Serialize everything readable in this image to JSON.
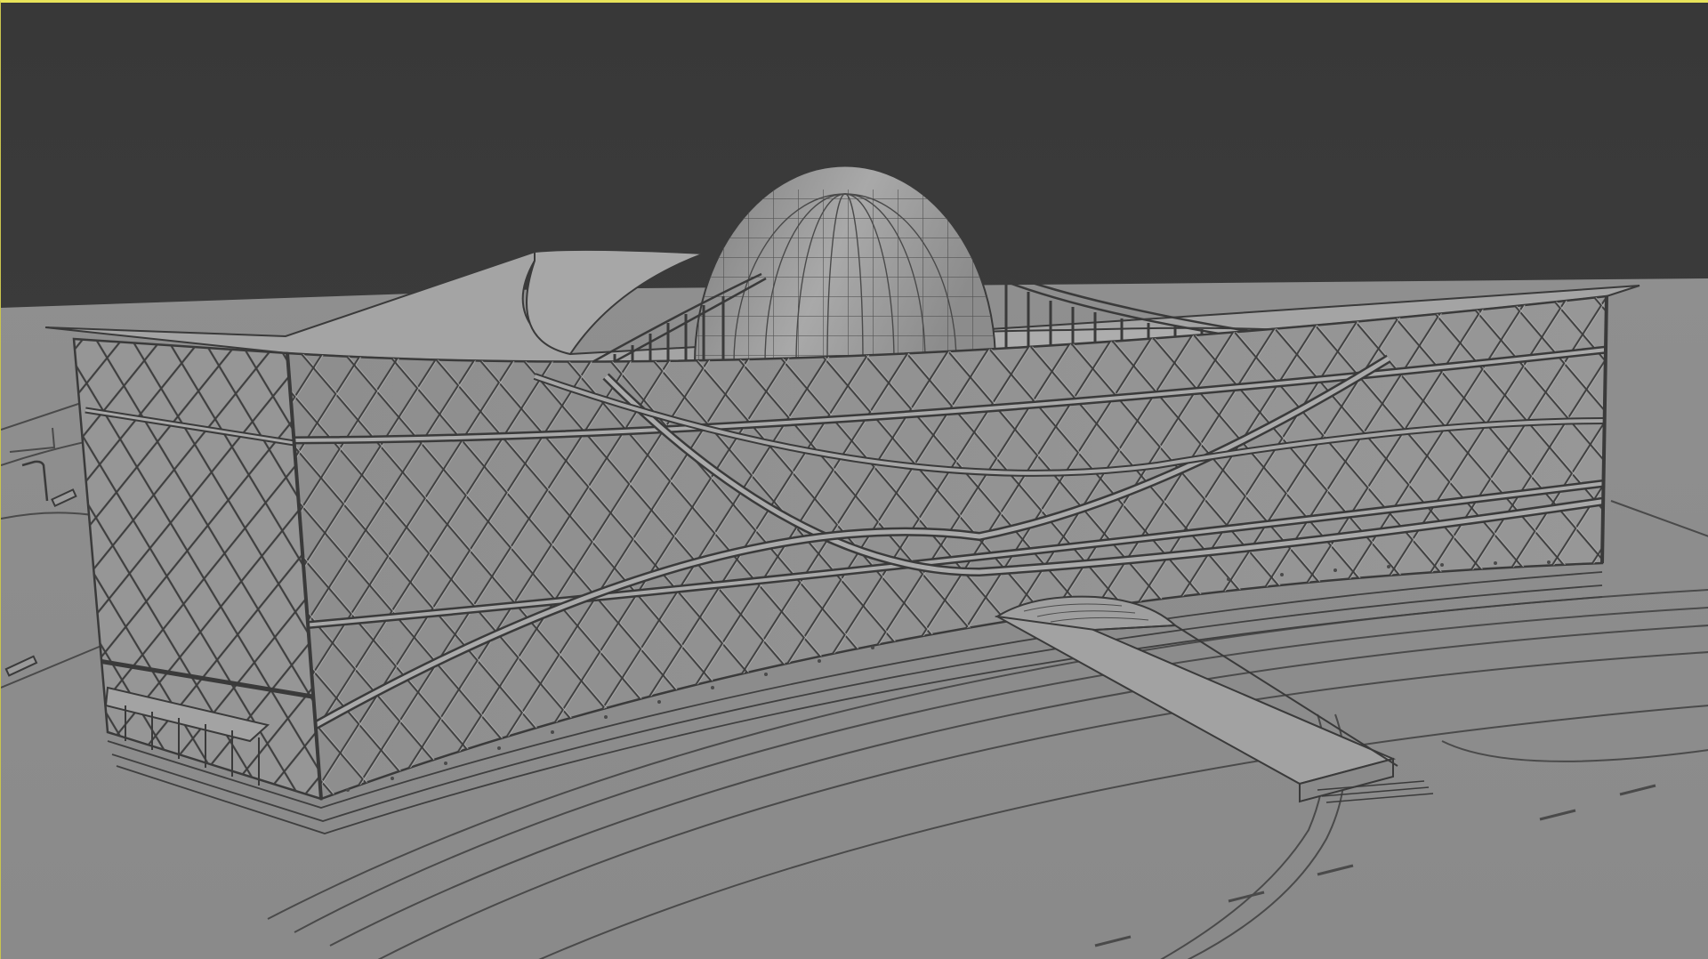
{
  "viewport": {
    "name": "3D Viewport",
    "shading": "solid",
    "active_border_color": "#e8e35a",
    "background_color": "#3d3d3d",
    "ground_color": "#8a8a8a",
    "model_base_color": "#9a9a9a",
    "wireframe_color": "#3c3c3c"
  },
  "scene": {
    "objects": [
      "ground-plane",
      "building-facade",
      "diagrid-lattice",
      "glass-dome",
      "roof-deck",
      "entrance-ramp",
      "roads",
      "street-lamp",
      "bench"
    ]
  }
}
